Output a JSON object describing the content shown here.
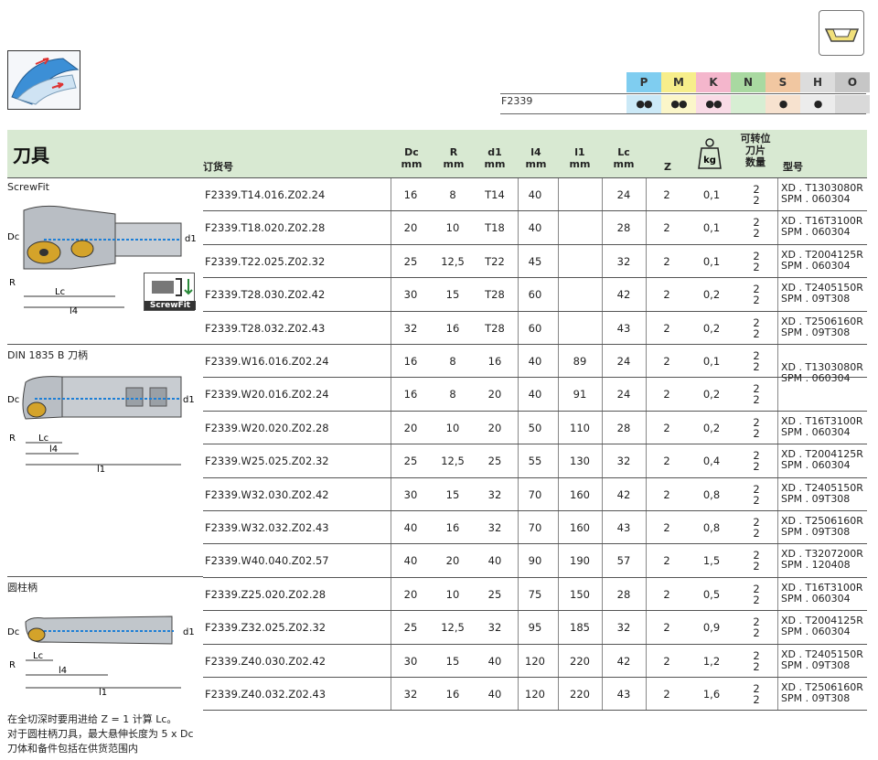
{
  "series": "F2339",
  "section_title": "刀具",
  "materials": [
    {
      "label": "P",
      "color": "#7fcdf0",
      "dots": "●●"
    },
    {
      "label": "M",
      "color": "#f7ee8b",
      "dots": "●●"
    },
    {
      "label": "K",
      "color": "#f4b6cc",
      "dots": "●●"
    },
    {
      "label": "N",
      "color": "#a9d9a1",
      "dots": ""
    },
    {
      "label": "S",
      "color": "#f1c7a1",
      "dots": "●"
    },
    {
      "label": "H",
      "color": "#dcdcdc",
      "dots": "●"
    },
    {
      "label": "O",
      "color": "#c6c6c6",
      "dots": ""
    }
  ],
  "headers": {
    "order": "订货号",
    "dc": "Dc",
    "dc_u": "mm",
    "r": "R",
    "r_u": "mm",
    "d1": "d1",
    "d1_u": "mm",
    "l4": "l4",
    "l4_u": "mm",
    "l1": "l1",
    "l1_u": "mm",
    "lc": "Lc",
    "lc_u": "mm",
    "z": "Z",
    "kg": "kg",
    "inserts_1": "可转位",
    "inserts_2": "刀片",
    "inserts_3": "数量",
    "type": "型号"
  },
  "sections": {
    "screwfit": "ScrewFit",
    "din": "DIN 1835 B 刀柄",
    "cyl": "圆柱柄",
    "screwfit_badge": "ScrewFit"
  },
  "rows": [
    {
      "code": "F2339.T14.016.Z02.24",
      "dc": "16",
      "r": "8",
      "d1": "T14",
      "l4": "40",
      "l1": "",
      "lc": "24",
      "z": "2",
      "kg": "0,1",
      "q1": "2",
      "q2": "2",
      "t1": "XD . T1303080R",
      "t2": "SPM . 060304"
    },
    {
      "code": "F2339.T18.020.Z02.28",
      "dc": "20",
      "r": "10",
      "d1": "T18",
      "l4": "40",
      "l1": "",
      "lc": "28",
      "z": "2",
      "kg": "0,1",
      "q1": "2",
      "q2": "2",
      "t1": "XD . T16T3100R",
      "t2": "SPM . 060304"
    },
    {
      "code": "F2339.T22.025.Z02.32",
      "dc": "25",
      "r": "12,5",
      "d1": "T22",
      "l4": "45",
      "l1": "",
      "lc": "32",
      "z": "2",
      "kg": "0,1",
      "q1": "2",
      "q2": "2",
      "t1": "XD . T2004125R",
      "t2": "SPM . 060304"
    },
    {
      "code": "F2339.T28.030.Z02.42",
      "dc": "30",
      "r": "15",
      "d1": "T28",
      "l4": "60",
      "l1": "",
      "lc": "42",
      "z": "2",
      "kg": "0,2",
      "q1": "2",
      "q2": "2",
      "t1": "XD . T2405150R",
      "t2": "SPM . 09T308"
    },
    {
      "code": "F2339.T28.032.Z02.43",
      "dc": "32",
      "r": "16",
      "d1": "T28",
      "l4": "60",
      "l1": "",
      "lc": "43",
      "z": "2",
      "kg": "0,2",
      "q1": "2",
      "q2": "2",
      "t1": "XD . T2506160R",
      "t2": "SPM . 09T308"
    },
    {
      "code": "F2339.W16.016.Z02.24",
      "dc": "16",
      "r": "8",
      "d1": "16",
      "l4": "40",
      "l1": "89",
      "lc": "24",
      "z": "2",
      "kg": "0,1",
      "q1": "2",
      "q2": "2",
      "t1": "",
      "t2": ""
    },
    {
      "code": "F2339.W20.016.Z02.24",
      "dc": "16",
      "r": "8",
      "d1": "20",
      "l4": "40",
      "l1": "91",
      "lc": "24",
      "z": "2",
      "kg": "0,2",
      "q1": "2",
      "q2": "2",
      "t1": "",
      "t2": ""
    },
    {
      "code": "F2339.W20.020.Z02.28",
      "dc": "20",
      "r": "10",
      "d1": "20",
      "l4": "50",
      "l1": "110",
      "lc": "28",
      "z": "2",
      "kg": "0,2",
      "q1": "2",
      "q2": "2",
      "t1": "XD . T16T3100R",
      "t2": "SPM . 060304"
    },
    {
      "code": "F2339.W25.025.Z02.32",
      "dc": "25",
      "r": "12,5",
      "d1": "25",
      "l4": "55",
      "l1": "130",
      "lc": "32",
      "z": "2",
      "kg": "0,4",
      "q1": "2",
      "q2": "2",
      "t1": "XD . T2004125R",
      "t2": "SPM . 060304"
    },
    {
      "code": "F2339.W32.030.Z02.42",
      "dc": "30",
      "r": "15",
      "d1": "32",
      "l4": "70",
      "l1": "160",
      "lc": "42",
      "z": "2",
      "kg": "0,8",
      "q1": "2",
      "q2": "2",
      "t1": "XD . T2405150R",
      "t2": "SPM . 09T308"
    },
    {
      "code": "F2339.W32.032.Z02.43",
      "dc": "40",
      "r": "16",
      "d1": "32",
      "l4": "70",
      "l1": "160",
      "lc": "43",
      "z": "2",
      "kg": "0,8",
      "q1": "2",
      "q2": "2",
      "t1": "XD . T2506160R",
      "t2": "SPM . 09T308"
    },
    {
      "code": "F2339.W40.040.Z02.57",
      "dc": "40",
      "r": "20",
      "d1": "40",
      "l4": "90",
      "l1": "190",
      "lc": "57",
      "z": "2",
      "kg": "1,5",
      "q1": "2",
      "q2": "2",
      "t1": "XD . T3207200R",
      "t2": "SPM . 120408"
    },
    {
      "code": "F2339.Z25.020.Z02.28",
      "dc": "20",
      "r": "10",
      "d1": "25",
      "l4": "75",
      "l1": "150",
      "lc": "28",
      "z": "2",
      "kg": "0,5",
      "q1": "2",
      "q2": "2",
      "t1": "XD . T16T3100R",
      "t2": "SPM . 060304"
    },
    {
      "code": "F2339.Z32.025.Z02.32",
      "dc": "25",
      "r": "12,5",
      "d1": "32",
      "l4": "95",
      "l1": "185",
      "lc": "32",
      "z": "2",
      "kg": "0,9",
      "q1": "2",
      "q2": "2",
      "t1": "XD . T2004125R",
      "t2": "SPM . 060304"
    },
    {
      "code": "F2339.Z40.030.Z02.42",
      "dc": "30",
      "r": "15",
      "d1": "40",
      "l4": "120",
      "l1": "220",
      "lc": "42",
      "z": "2",
      "kg": "1,2",
      "q1": "2",
      "q2": "2",
      "t1": "XD . T2405150R",
      "t2": "SPM . 09T308"
    },
    {
      "code": "F2339.Z40.032.Z02.43",
      "dc": "32",
      "r": "16",
      "d1": "40",
      "l4": "120",
      "l1": "220",
      "lc": "43",
      "z": "2",
      "kg": "1,6",
      "q1": "2",
      "q2": "2",
      "t1": "XD . T2506160R",
      "t2": "SPM . 09T308"
    }
  ],
  "merged_type": {
    "t1": "XD . T1303080R",
    "t2": "SPM . 060304"
  },
  "footer": {
    "line1": "在全切深时要用进给 Z = 1 计算 Lc。",
    "line2": "对于圆柱柄刀具，最大悬伸长度为 5 x Dc",
    "line3": "刀体和备件包括在供货范围内"
  },
  "diagram_labels": {
    "dc": "Dc",
    "d1": "d1",
    "r": "R",
    "lc": "Lc",
    "l4": "l4",
    "l1": "l1"
  }
}
